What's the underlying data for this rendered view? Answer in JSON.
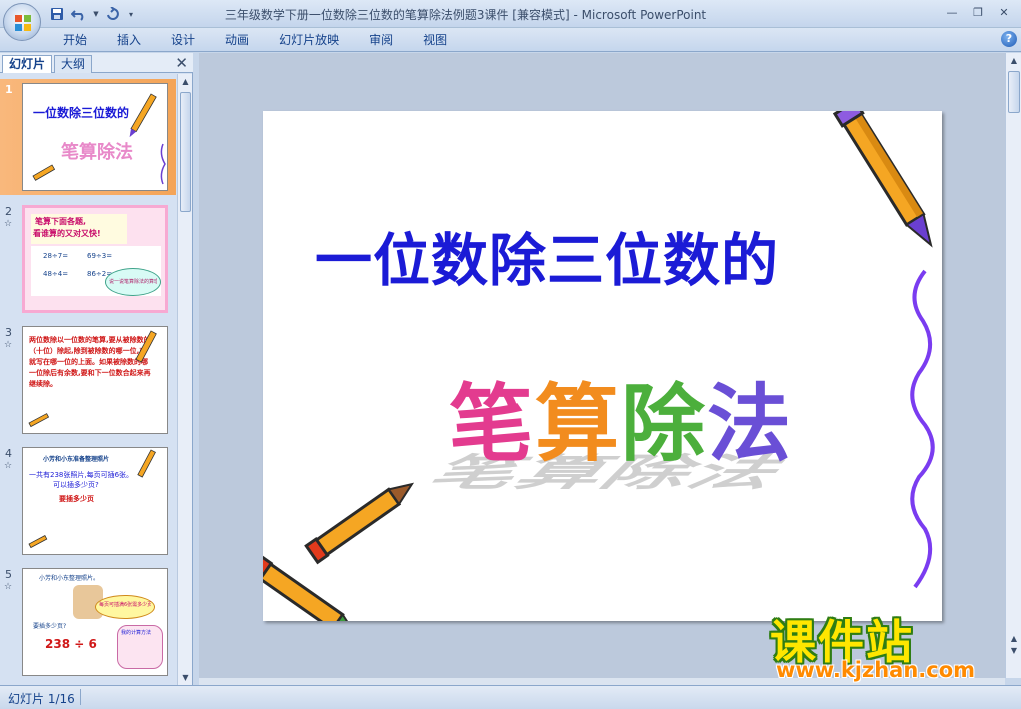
{
  "window": {
    "title": "三年级数学下册一位数除三位数的笔算除法例题3课件 [兼容模式]",
    "title_sep": " - ",
    "app_name": "Microsoft PowerPoint"
  },
  "ribbon": {
    "tabs": [
      "开始",
      "插入",
      "设计",
      "动画",
      "幻灯片放映",
      "审阅",
      "视图"
    ]
  },
  "panel": {
    "tab_slides": "幻灯片",
    "tab_outline": "大纲"
  },
  "thumbnails": [
    {
      "number": "1",
      "selected": true,
      "title": "一位数除三位数的",
      "subtitle": "笔算除法"
    },
    {
      "number": "2",
      "selected": false,
      "line1": "笔算下面各题,",
      "line2": "看谁算的又对又快!",
      "eq1": "28÷7=",
      "eq2": "69÷3=",
      "eq3": "48÷4=",
      "eq4": "86÷2=",
      "bubble": "说一说笔算除法的算理"
    },
    {
      "number": "3",
      "selected": false,
      "text": "两位数除以一位数的笔算,要从被除数的（十位）除起,除到被除数的哪一位,商就写在哪一位的上面。如果被除数的哪一位除后有余数,要和下一位数合起来再继续除。"
    },
    {
      "number": "4",
      "selected": false,
      "header": "小芳和小东准备整理照片",
      "q1": "一共有238张照片,每页可插6张。",
      "q2": "可以插多少页?",
      "q3": "要插多少页"
    },
    {
      "number": "5",
      "selected": false,
      "header": "小芳和小东整理照片。",
      "q": "要插多少页?",
      "eq": "238 ÷ 6",
      "bubble1": "每页可插满6张需多少页?",
      "bubble2": "我的计算方法"
    }
  ],
  "slide": {
    "title": "一位数除三位数的",
    "wordart": [
      "笔",
      "算",
      "除",
      "法"
    ]
  },
  "status": {
    "slide_indicator": "幻灯片 1/16"
  },
  "watermark": {
    "brand": "课件站",
    "url": "www.kjzhan.com"
  },
  "colors": {
    "title_blue": "#1b1bd6",
    "selection_orange": "#f4a457",
    "brand_yellow": "#ffe600",
    "url_orange": "#ff8a00"
  }
}
